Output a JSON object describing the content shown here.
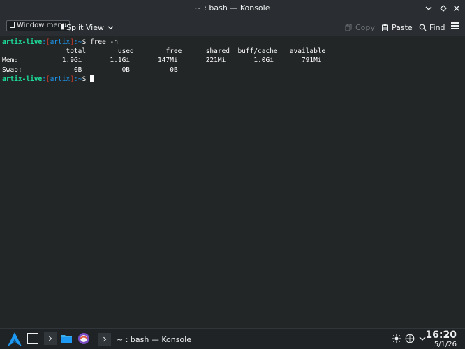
{
  "window": {
    "title": "~ : bash — Konsole"
  },
  "toolbar": {
    "tooltip": "Window menu",
    "split_view": "Split View",
    "copy": "Copy",
    "paste": "Paste",
    "find": "Find"
  },
  "terminal": {
    "prompt": {
      "user": "artix-live",
      "dir": "artix",
      "path": "~",
      "symbol": "$"
    },
    "command": "free -h",
    "header": "                total        used        free      shared  buff/cache   available",
    "mem_row": "Mem:           1.9Gi       1.1Gi       147Mi       221Mi       1.0Gi       791Mi",
    "swap_row": "Swap:             0B          0B          0B"
  },
  "taskbar": {
    "task_title": "~ : bash — Konsole",
    "time": "16:20",
    "date": "5/1/26"
  },
  "colors": {
    "prompt_green": "#1cdc9a",
    "bracket_red": "#c0392b",
    "dir_blue": "#1d99f3",
    "accent": "#1d99f3"
  }
}
